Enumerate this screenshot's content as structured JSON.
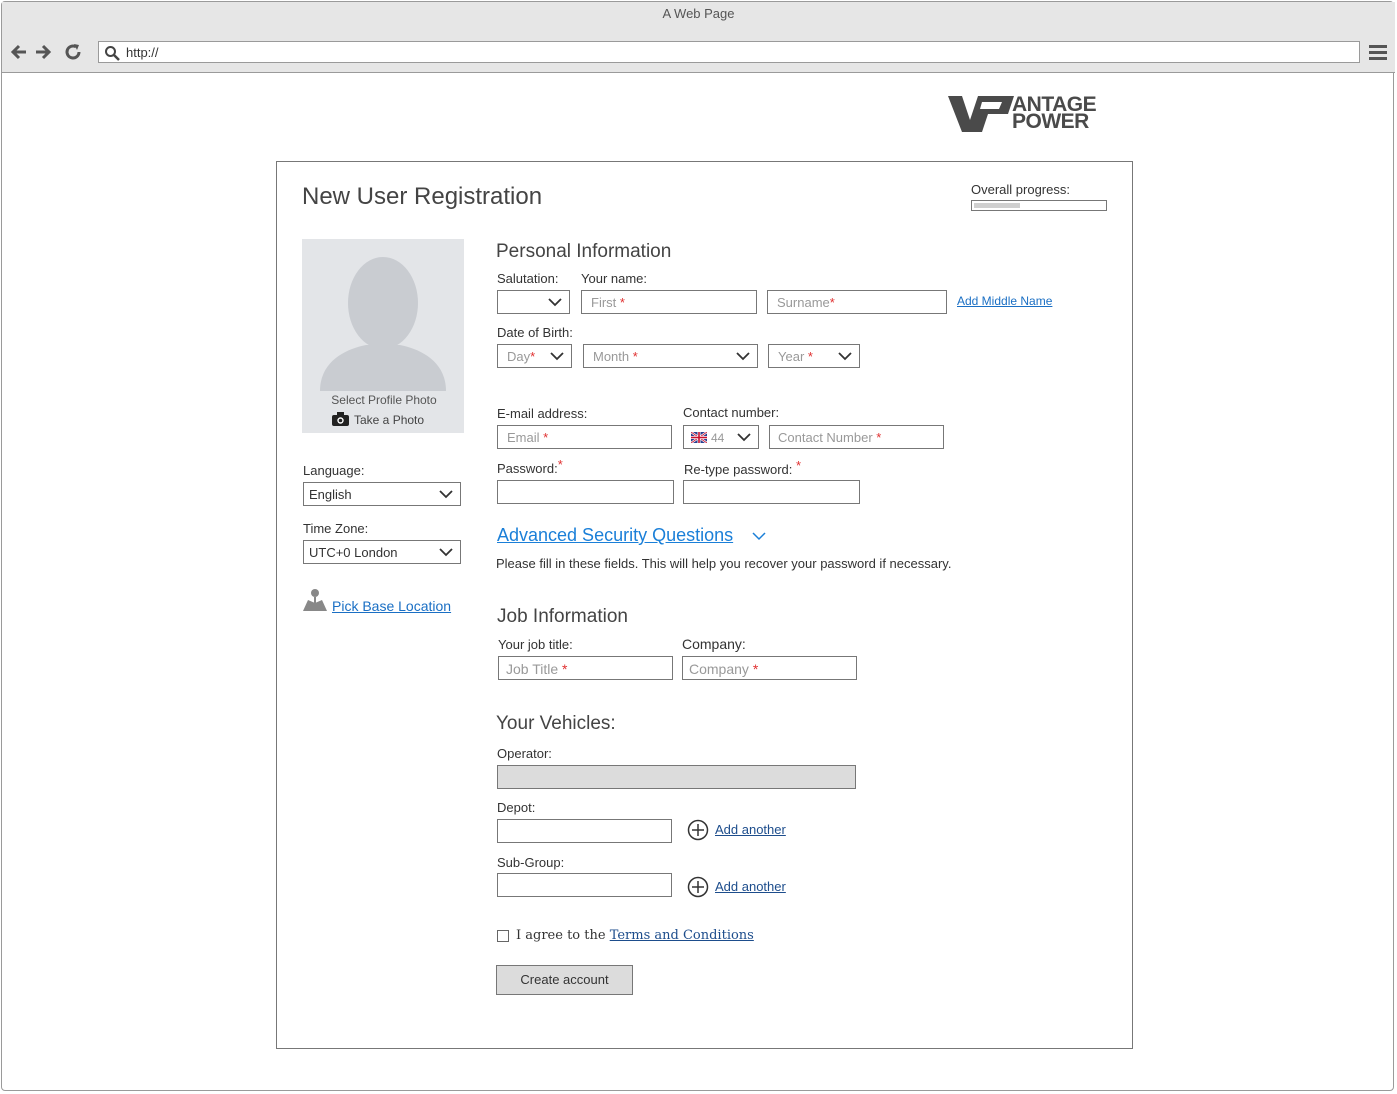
{
  "browser": {
    "title": "A Web Page",
    "url": "http://"
  },
  "logo": {
    "text_top": "ANTAGE",
    "text_bottom": "POWER",
    "mark": "VP"
  },
  "form": {
    "title": "New User Registration",
    "progress": {
      "label": "Overall progress:",
      "fraction": 0.35
    },
    "photo": {
      "select_label": "Select Profile Photo",
      "take_label": "Take a Photo"
    },
    "language": {
      "label": "Language:",
      "value": "English"
    },
    "timezone": {
      "label": "Time Zone:",
      "value": "UTC+0 London"
    },
    "location_link": "Pick Base Location",
    "personal": {
      "heading": "Personal Information",
      "salutation_label": "Salutation:",
      "name_label": "Your name:",
      "first_placeholder": "First",
      "surname_placeholder": "Surname",
      "add_middle": "Add Middle Name",
      "dob_label": "Date of Birth:",
      "day_placeholder": "Day",
      "month_placeholder": "Month",
      "year_placeholder": "Year",
      "email_label": "E-mail address:",
      "email_placeholder": "Email",
      "contact_label": "Contact number:",
      "country_code": "44",
      "contact_placeholder": "Contact Number",
      "password_label": "Password:",
      "retype_label": "Re-type password:",
      "required_mark": "*"
    },
    "security": {
      "link": "Advanced Security Questions",
      "hint": "Please fill in these fields. This will help you recover your password if necessary."
    },
    "job": {
      "heading": "Job Information",
      "title_label": "Your job title:",
      "title_placeholder": "Job Title",
      "company_label": "Company:",
      "company_placeholder": "Company"
    },
    "vehicles": {
      "heading": "Your Vehicles:",
      "operator_label": "Operator:",
      "depot_label": "Depot:",
      "subgroup_label": "Sub-Group:",
      "add_another": "Add another"
    },
    "terms": {
      "prefix": "I agree to the",
      "link": "Terms and Conditions"
    },
    "submit": "Create account"
  },
  "colors": {
    "link": "#1a6fc4",
    "required": "#e03030"
  }
}
